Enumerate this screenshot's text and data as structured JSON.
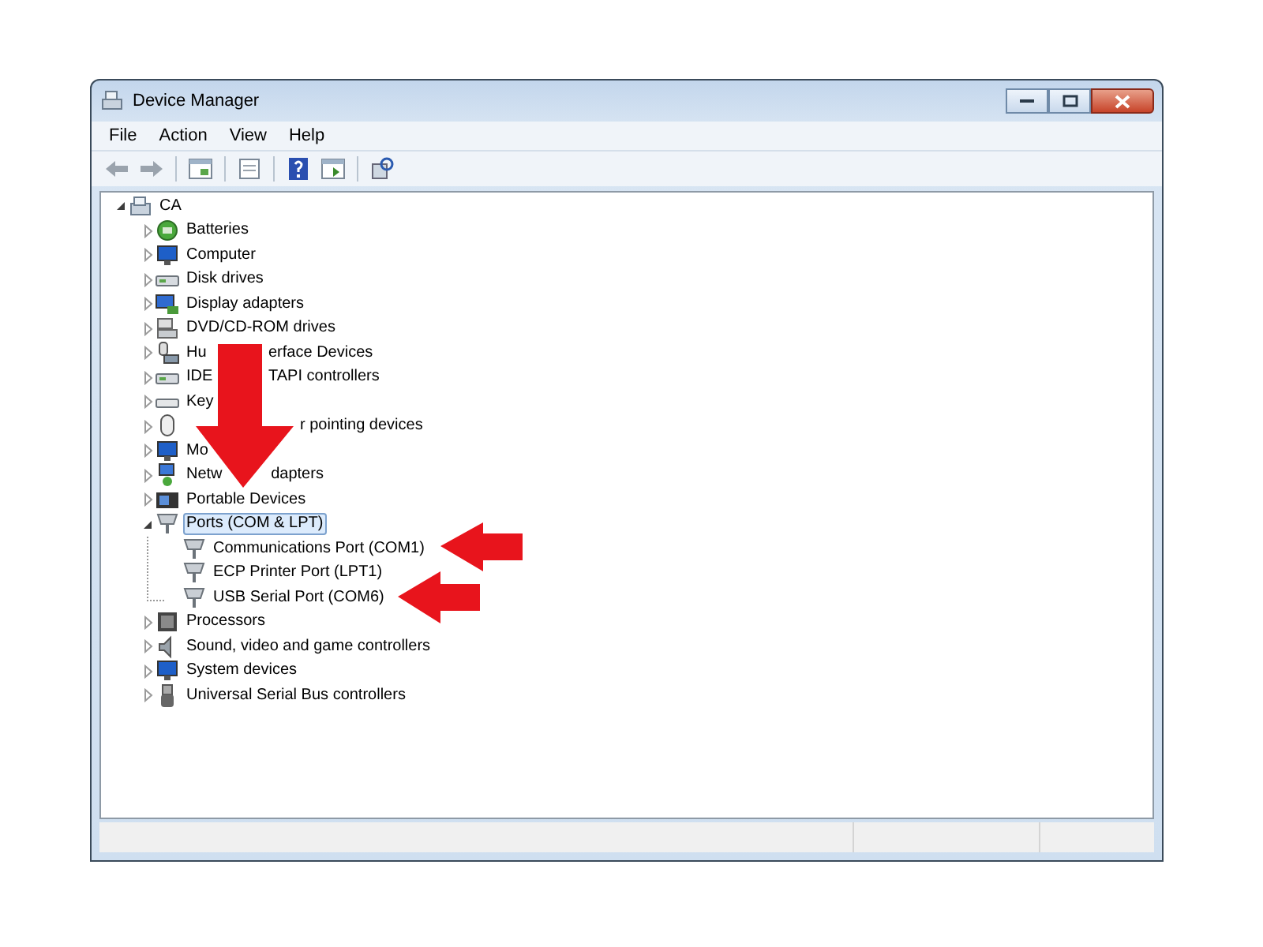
{
  "window": {
    "title": "Device Manager"
  },
  "menu": [
    {
      "label": "File"
    },
    {
      "label": "Action"
    },
    {
      "label": "View"
    },
    {
      "label": "Help"
    }
  ],
  "tree": [
    {
      "label": "CA",
      "kind": "computer",
      "expanded": true,
      "selected": false,
      "children": [
        {
          "label": "Batteries",
          "kind": "battery",
          "expanded": false,
          "selected": false
        },
        {
          "label": "Computer",
          "kind": "monitor",
          "expanded": false,
          "selected": false
        },
        {
          "label": "Disk drives",
          "kind": "disk",
          "expanded": false,
          "selected": false
        },
        {
          "label": "Display adapters",
          "kind": "display",
          "expanded": false,
          "selected": false
        },
        {
          "label": "DVD/CD-ROM drives",
          "kind": "drive",
          "expanded": false,
          "selected": false
        },
        {
          "label": "Hu",
          "label_end": "erface Devices",
          "kind": "hid",
          "expanded": false,
          "selected": false
        },
        {
          "label": "IDE",
          "label_end": "TAPI controllers",
          "kind": "disk",
          "expanded": false,
          "selected": false
        },
        {
          "label": "Key",
          "kind": "keyboard",
          "expanded": false,
          "selected": false
        },
        {
          "label_end": "r pointing devices",
          "kind": "mouse",
          "expanded": false,
          "selected": false
        },
        {
          "label": "Mo",
          "kind": "monitor",
          "expanded": false,
          "selected": false
        },
        {
          "label": "Netw",
          "label_end": "dapters",
          "kind": "network",
          "expanded": false,
          "selected": false
        },
        {
          "label": "Portable Devices",
          "kind": "portable",
          "expanded": false,
          "selected": false
        },
        {
          "label": "Ports (COM & LPT)",
          "kind": "port",
          "expanded": true,
          "selected": true,
          "children": [
            {
              "label": "Communications Port (COM1)",
              "kind": "port",
              "selected": false
            },
            {
              "label": "ECP Printer Port (LPT1)",
              "kind": "port",
              "selected": false
            },
            {
              "label": "USB Serial Port (COM6)",
              "kind": "port",
              "selected": false
            }
          ]
        },
        {
          "label": "Processors",
          "kind": "processor",
          "expanded": false,
          "selected": false
        },
        {
          "label": "Sound, video and game controllers",
          "kind": "sound",
          "expanded": false,
          "selected": false
        },
        {
          "label": "System devices",
          "kind": "monitor",
          "expanded": false,
          "selected": false
        },
        {
          "label": "Universal Serial Bus controllers",
          "kind": "usb",
          "expanded": false,
          "selected": false
        }
      ]
    }
  ]
}
